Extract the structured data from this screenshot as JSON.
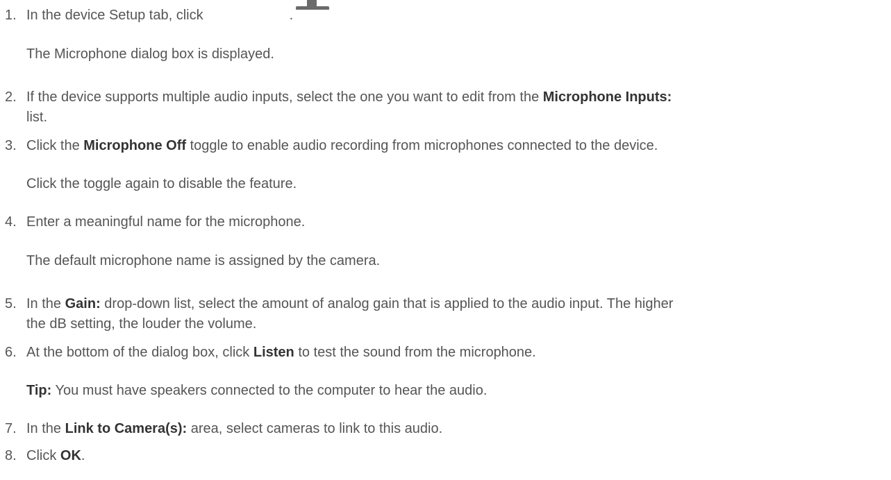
{
  "steps": [
    {
      "num": "1.",
      "pre": "In the device Setup tab, click",
      "icon": "microphone-icon",
      "post": ".",
      "note": "The Microphone dialog box is displayed."
    },
    {
      "num": "2.",
      "pre": "If the device supports multiple audio inputs, select the one you want to edit from the ",
      "bold": "Microphone Inputs:",
      "post": "list."
    },
    {
      "num": "3.",
      "pre": "Click the ",
      "bold": "Microphone Off",
      "post": " toggle to enable audio recording from microphones connected to the device.",
      "note": "Click the toggle again to disable the feature."
    },
    {
      "num": "4.",
      "text": "Enter a meaningful name for the microphone.",
      "note": "The default microphone name is assigned by the camera."
    },
    {
      "num": "5.",
      "pre": "In the ",
      "bold": "Gain:",
      "post": " drop-down list, select the amount of analog gain that is applied to the audio input. The higher",
      "post2": "the dB setting, the louder the volume."
    },
    {
      "num": "6.",
      "pre": "At the bottom of the dialog box, click ",
      "bold": "Listen",
      "post": " to test the sound from the microphone.",
      "tip_label": "Tip:",
      "tip_text": " You must have speakers connected to the computer to hear the audio."
    },
    {
      "num": "7.",
      "pre": "In the ",
      "bold": "Link to Camera(s):",
      "post": " area, select cameras to link to this audio."
    },
    {
      "num": "8.",
      "pre": "Click ",
      "bold": "OK",
      "post": "."
    }
  ]
}
